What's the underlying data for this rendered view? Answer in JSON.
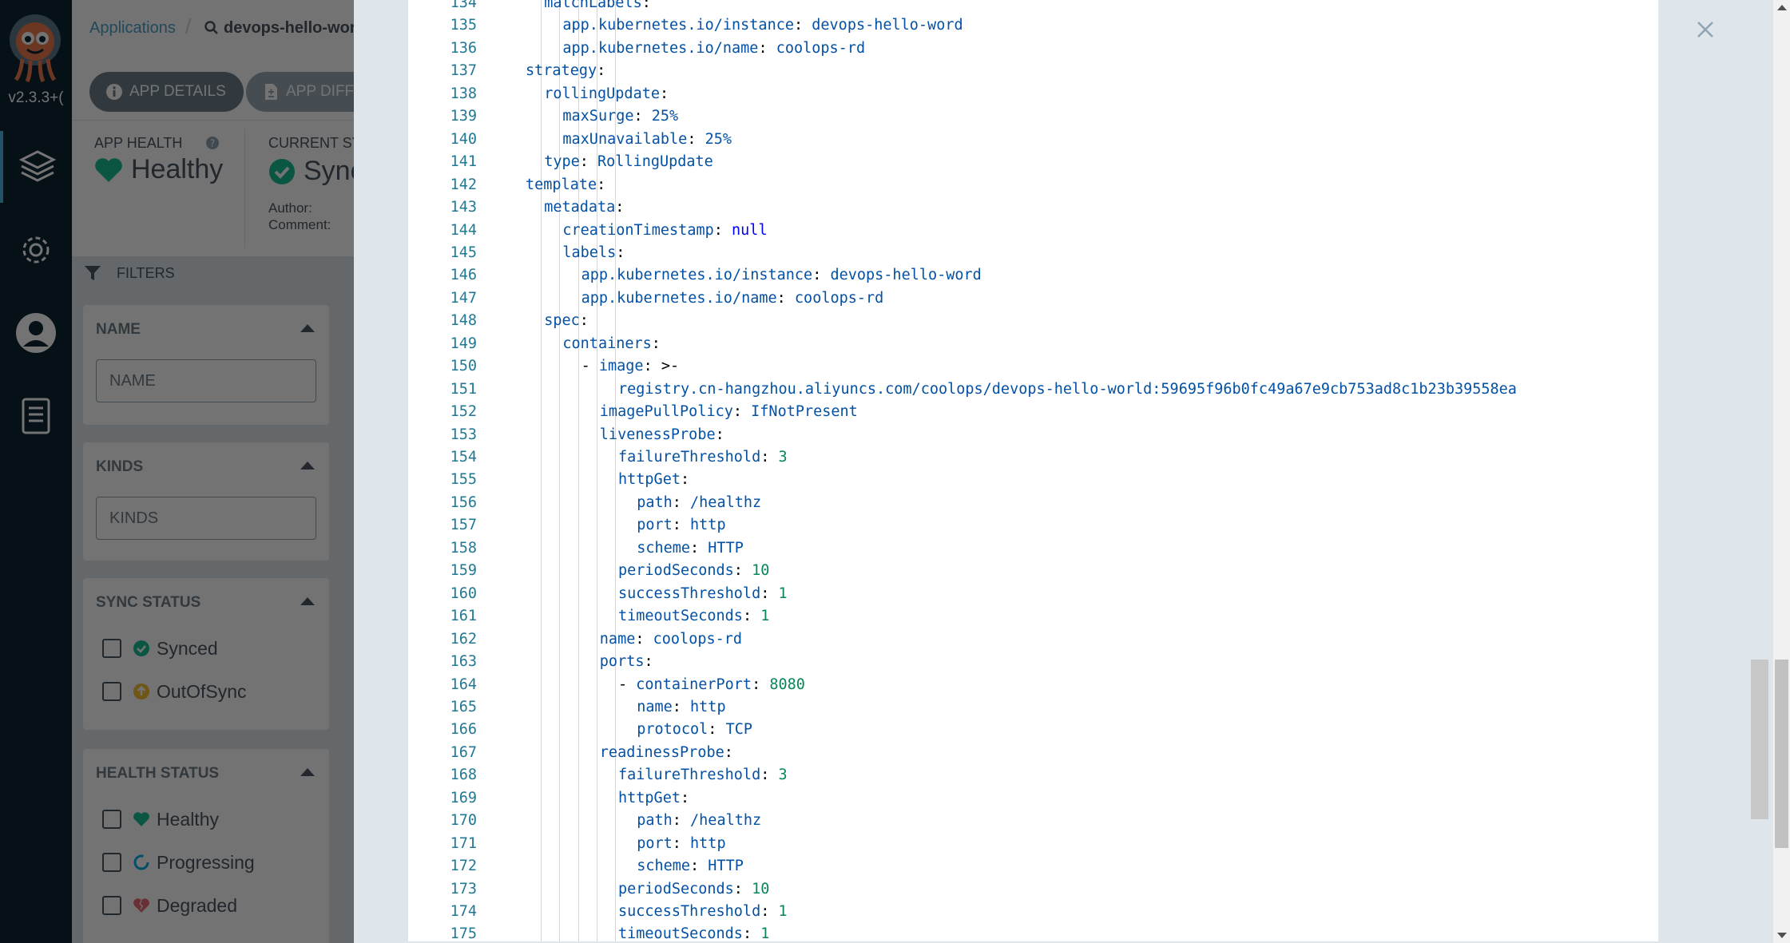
{
  "nav": {
    "version": "v2.3.3+(",
    "items": [
      "applications-icon",
      "settings-icon",
      "user-icon",
      "docs-icon"
    ]
  },
  "app": {
    "breadcrumb": {
      "root": "Applications",
      "current": "devops-hello-word"
    },
    "buttons": {
      "details": "APP DETAILS",
      "diff": "APP DIFF"
    },
    "health": {
      "label": "APP HEALTH",
      "value": "Healthy"
    },
    "sync": {
      "label": "CURRENT SY",
      "value": "Sync",
      "author": "Author:",
      "comment": "Comment:"
    },
    "filters": {
      "title": "FILTERS",
      "name": {
        "title": "NAME",
        "placeholder": "NAME"
      },
      "kinds": {
        "title": "KINDS",
        "placeholder": "KINDS"
      },
      "sync_status": {
        "title": "SYNC STATUS",
        "options": [
          "Synced",
          "OutOfSync"
        ]
      },
      "health_status": {
        "title": "HEALTH STATUS",
        "options": [
          "Healthy",
          "Progressing",
          "Degraded"
        ]
      }
    }
  },
  "colors": {
    "healthy": "#18be94",
    "outofsync": "#f4c030",
    "degraded": "#e96d76",
    "progressing": "#0dadea"
  },
  "editor": {
    "lines": [
      {
        "n": "134",
        "i": 1,
        "seg": [
          [
            "k",
            "matchLabels"
          ],
          [
            "p",
            ":"
          ]
        ]
      },
      {
        "n": "135",
        "i": 2,
        "seg": [
          [
            "k",
            "app.kubernetes.io/instance"
          ],
          [
            "p",
            ": "
          ],
          [
            "v",
            "devops-hello-word"
          ]
        ]
      },
      {
        "n": "136",
        "i": 2,
        "seg": [
          [
            "k",
            "app.kubernetes.io/name"
          ],
          [
            "p",
            ": "
          ],
          [
            "v",
            "coolops-rd"
          ]
        ]
      },
      {
        "n": "137",
        "i": 0,
        "seg": [
          [
            "k",
            "strategy"
          ],
          [
            "p",
            ":"
          ]
        ]
      },
      {
        "n": "138",
        "i": 1,
        "seg": [
          [
            "k",
            "rollingUpdate"
          ],
          [
            "p",
            ":"
          ]
        ]
      },
      {
        "n": "139",
        "i": 2,
        "seg": [
          [
            "k",
            "maxSurge"
          ],
          [
            "p",
            ": "
          ],
          [
            "v",
            "25%"
          ]
        ]
      },
      {
        "n": "140",
        "i": 2,
        "seg": [
          [
            "k",
            "maxUnavailable"
          ],
          [
            "p",
            ": "
          ],
          [
            "v",
            "25%"
          ]
        ]
      },
      {
        "n": "141",
        "i": 1,
        "seg": [
          [
            "k",
            "type"
          ],
          [
            "p",
            ": "
          ],
          [
            "v",
            "RollingUpdate"
          ]
        ]
      },
      {
        "n": "142",
        "i": 0,
        "seg": [
          [
            "k",
            "template"
          ],
          [
            "p",
            ":"
          ]
        ]
      },
      {
        "n": "143",
        "i": 1,
        "seg": [
          [
            "k",
            "metadata"
          ],
          [
            "p",
            ":"
          ]
        ]
      },
      {
        "n": "144",
        "i": 2,
        "seg": [
          [
            "k",
            "creationTimestamp"
          ],
          [
            "p",
            ": "
          ],
          [
            "kw",
            "null"
          ]
        ]
      },
      {
        "n": "145",
        "i": 2,
        "seg": [
          [
            "k",
            "labels"
          ],
          [
            "p",
            ":"
          ]
        ]
      },
      {
        "n": "146",
        "i": 3,
        "seg": [
          [
            "k",
            "app.kubernetes.io/instance"
          ],
          [
            "p",
            ": "
          ],
          [
            "v",
            "devops-hello-word"
          ]
        ]
      },
      {
        "n": "147",
        "i": 3,
        "seg": [
          [
            "k",
            "app.kubernetes.io/name"
          ],
          [
            "p",
            ": "
          ],
          [
            "v",
            "coolops-rd"
          ]
        ]
      },
      {
        "n": "148",
        "i": 1,
        "seg": [
          [
            "k",
            "spec"
          ],
          [
            "p",
            ":"
          ]
        ]
      },
      {
        "n": "149",
        "i": 2,
        "seg": [
          [
            "k",
            "containers"
          ],
          [
            "p",
            ":"
          ]
        ]
      },
      {
        "n": "150",
        "i": 3,
        "seg": [
          [
            "p",
            "- "
          ],
          [
            "k",
            "image"
          ],
          [
            "p",
            ": >-"
          ]
        ]
      },
      {
        "n": "151",
        "i": 5,
        "seg": [
          [
            "v",
            "registry.cn-hangzhou.aliyuncs.com/coolops/devops-hello-world:59695f96b0fc49a67e9cb753ad8c1b23b39558ea"
          ]
        ]
      },
      {
        "n": "152",
        "i": 4,
        "seg": [
          [
            "k",
            "imagePullPolicy"
          ],
          [
            "p",
            ": "
          ],
          [
            "v",
            "IfNotPresent"
          ]
        ]
      },
      {
        "n": "153",
        "i": 4,
        "seg": [
          [
            "k",
            "livenessProbe"
          ],
          [
            "p",
            ":"
          ]
        ]
      },
      {
        "n": "154",
        "i": 5,
        "seg": [
          [
            "k",
            "failureThreshold"
          ],
          [
            "p",
            ": "
          ],
          [
            "num",
            "3"
          ]
        ]
      },
      {
        "n": "155",
        "i": 5,
        "seg": [
          [
            "k",
            "httpGet"
          ],
          [
            "p",
            ":"
          ]
        ]
      },
      {
        "n": "156",
        "i": 6,
        "seg": [
          [
            "k",
            "path"
          ],
          [
            "p",
            ": "
          ],
          [
            "v",
            "/healthz"
          ]
        ]
      },
      {
        "n": "157",
        "i": 6,
        "seg": [
          [
            "k",
            "port"
          ],
          [
            "p",
            ": "
          ],
          [
            "v",
            "http"
          ]
        ]
      },
      {
        "n": "158",
        "i": 6,
        "seg": [
          [
            "k",
            "scheme"
          ],
          [
            "p",
            ": "
          ],
          [
            "v",
            "HTTP"
          ]
        ]
      },
      {
        "n": "159",
        "i": 5,
        "seg": [
          [
            "k",
            "periodSeconds"
          ],
          [
            "p",
            ": "
          ],
          [
            "num",
            "10"
          ]
        ]
      },
      {
        "n": "160",
        "i": 5,
        "seg": [
          [
            "k",
            "successThreshold"
          ],
          [
            "p",
            ": "
          ],
          [
            "num",
            "1"
          ]
        ]
      },
      {
        "n": "161",
        "i": 5,
        "seg": [
          [
            "k",
            "timeoutSeconds"
          ],
          [
            "p",
            ": "
          ],
          [
            "num",
            "1"
          ]
        ]
      },
      {
        "n": "162",
        "i": 4,
        "seg": [
          [
            "k",
            "name"
          ],
          [
            "p",
            ": "
          ],
          [
            "v",
            "coolops-rd"
          ]
        ]
      },
      {
        "n": "163",
        "i": 4,
        "seg": [
          [
            "k",
            "ports"
          ],
          [
            "p",
            ":"
          ]
        ]
      },
      {
        "n": "164",
        "i": 5,
        "seg": [
          [
            "p",
            "- "
          ],
          [
            "k",
            "containerPort"
          ],
          [
            "p",
            ": "
          ],
          [
            "num",
            "8080"
          ]
        ]
      },
      {
        "n": "165",
        "i": 6,
        "seg": [
          [
            "k",
            "name"
          ],
          [
            "p",
            ": "
          ],
          [
            "v",
            "http"
          ]
        ]
      },
      {
        "n": "166",
        "i": 6,
        "seg": [
          [
            "k",
            "protocol"
          ],
          [
            "p",
            ": "
          ],
          [
            "v",
            "TCP"
          ]
        ]
      },
      {
        "n": "167",
        "i": 4,
        "seg": [
          [
            "k",
            "readinessProbe"
          ],
          [
            "p",
            ":"
          ]
        ]
      },
      {
        "n": "168",
        "i": 5,
        "seg": [
          [
            "k",
            "failureThreshold"
          ],
          [
            "p",
            ": "
          ],
          [
            "num",
            "3"
          ]
        ]
      },
      {
        "n": "169",
        "i": 5,
        "seg": [
          [
            "k",
            "httpGet"
          ],
          [
            "p",
            ":"
          ]
        ]
      },
      {
        "n": "170",
        "i": 6,
        "seg": [
          [
            "k",
            "path"
          ],
          [
            "p",
            ": "
          ],
          [
            "v",
            "/healthz"
          ]
        ]
      },
      {
        "n": "171",
        "i": 6,
        "seg": [
          [
            "k",
            "port"
          ],
          [
            "p",
            ": "
          ],
          [
            "v",
            "http"
          ]
        ]
      },
      {
        "n": "172",
        "i": 6,
        "seg": [
          [
            "k",
            "scheme"
          ],
          [
            "p",
            ": "
          ],
          [
            "v",
            "HTTP"
          ]
        ]
      },
      {
        "n": "173",
        "i": 5,
        "seg": [
          [
            "k",
            "periodSeconds"
          ],
          [
            "p",
            ": "
          ],
          [
            "num",
            "10"
          ]
        ]
      },
      {
        "n": "174",
        "i": 5,
        "seg": [
          [
            "k",
            "successThreshold"
          ],
          [
            "p",
            ": "
          ],
          [
            "num",
            "1"
          ]
        ]
      },
      {
        "n": "175",
        "i": 5,
        "seg": [
          [
            "k",
            "timeoutSeconds"
          ],
          [
            "p",
            ": "
          ],
          [
            "num",
            "1"
          ]
        ]
      }
    ]
  }
}
